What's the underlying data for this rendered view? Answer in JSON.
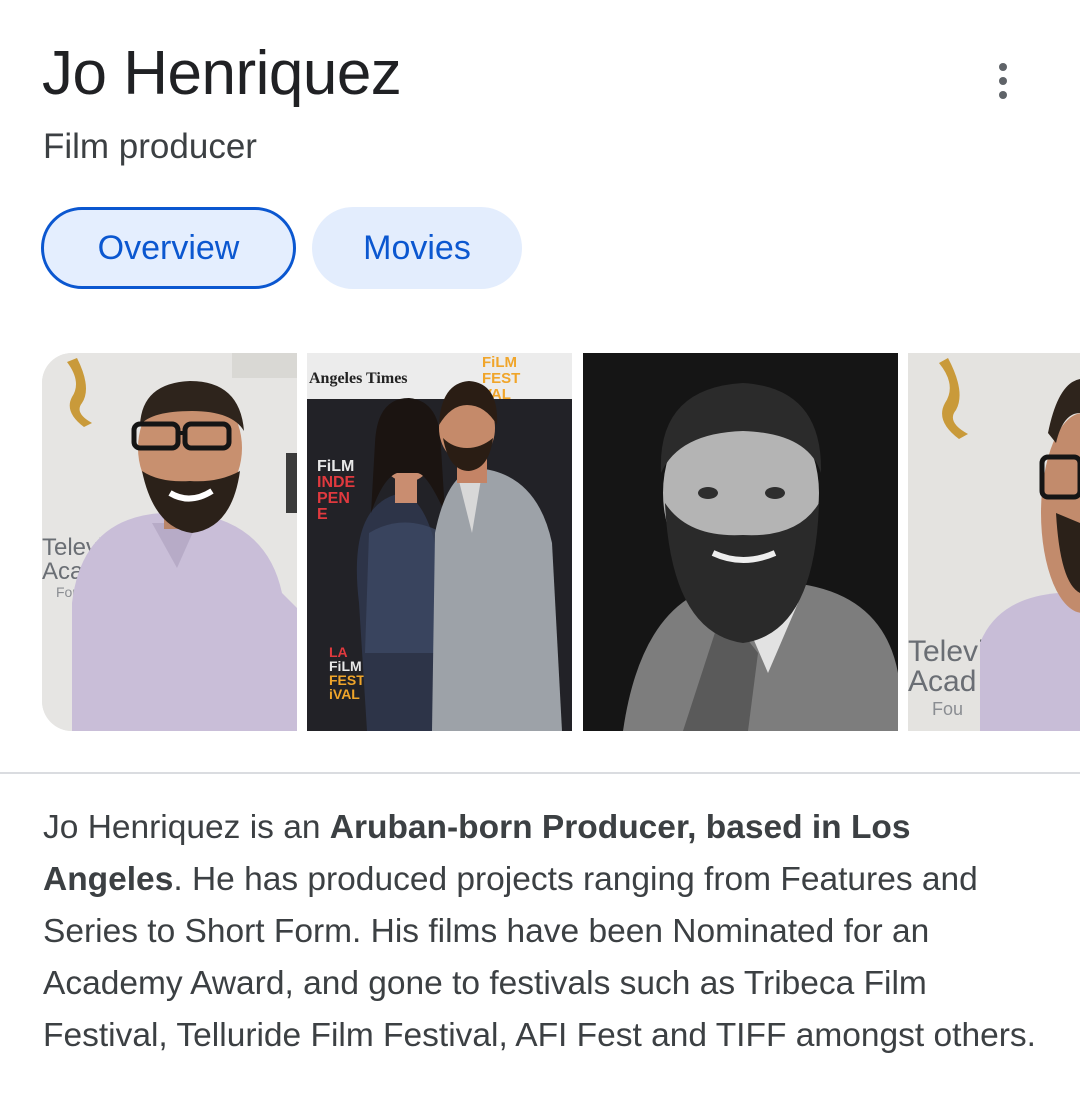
{
  "profile": {
    "name": "Jo Henriquez",
    "subtitle": "Film producer"
  },
  "tabs": [
    {
      "label": "Overview",
      "selected": true
    },
    {
      "label": "Movies",
      "selected": false
    }
  ],
  "images": {
    "photo1_sign": [
      "Televi",
      "Acad",
      "Fou"
    ],
    "photo2_header": "Angeles Times",
    "photo2_fest_top": [
      "FiLM",
      "FEST",
      "VAL"
    ],
    "photo2_film": [
      "FiLM",
      "INDE",
      "PEN",
      "E"
    ],
    "photo2_la": [
      "LA",
      "FiLM",
      "FEST",
      "iVAL"
    ],
    "photo4_sign": [
      "Televi",
      "Acad",
      "Fou"
    ]
  },
  "description": {
    "t1": "Jo Henriquez is an ",
    "b1": "Aruban-born Producer, based in Los Angeles",
    "t2": ". He has produced projects ranging from Features and Series to Short Form. His films have been Nominated for an Academy Award, and gone to festivals such as Tribeca Film Festival, Telluride Film Festival, AFI Fest and TIFF amongst others."
  },
  "colors": {
    "accent": "#0b57d0",
    "chip_bg": "#e3edfd",
    "text_primary": "#202124",
    "text_secondary": "#3c4043"
  }
}
